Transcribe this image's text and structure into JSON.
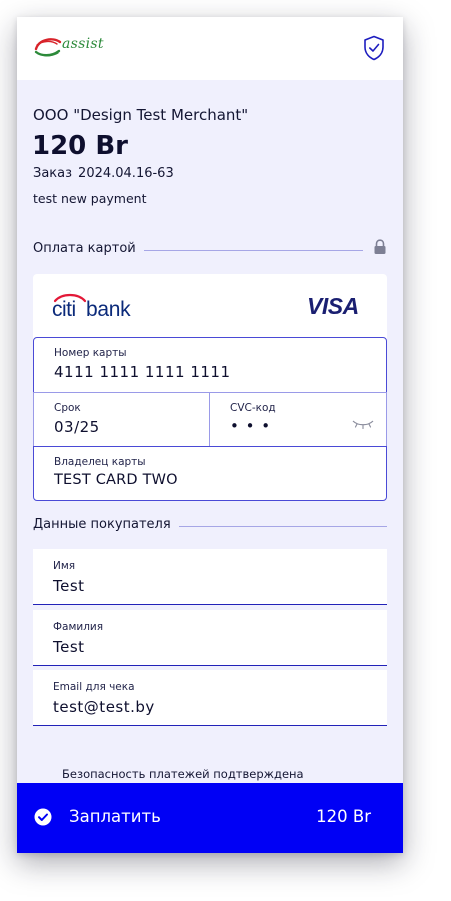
{
  "header": {
    "logo_text": "assist",
    "shield_icon": "shield-check-icon"
  },
  "summary": {
    "merchant": "ООО \"Design Test Merchant\"",
    "amount": "120 Br",
    "order_label": "Заказ",
    "order_number": "2024.04.16-63",
    "description": "test new payment"
  },
  "card_section": {
    "title": "Оплата картой",
    "lock_icon": "lock-icon",
    "bank_name": "citibank",
    "network": "VISA",
    "pan": {
      "label": "Номер карты",
      "value": "4111  1111  1111  1111"
    },
    "expiry": {
      "label": "Срок",
      "value": "03/25"
    },
    "cvc": {
      "label": "CVC-код",
      "value": "• • •"
    },
    "holder": {
      "label": "Владелец карты",
      "value": "TEST CARD TWO"
    }
  },
  "buyer_section": {
    "title": "Данные покупателя",
    "first_name": {
      "label": "Имя",
      "value": "Test"
    },
    "last_name": {
      "label": "Фамилия",
      "value": "Test"
    },
    "email": {
      "label": "Email для чека",
      "value": "test@test.by"
    }
  },
  "footer": {
    "security_note": "Безопасность платежей подтверждена",
    "pay_label": "Заплатить",
    "pay_amount": "120 Br"
  },
  "colors": {
    "accent": "#0000f5",
    "background": "#f0f0fd",
    "field_border": "#4a4ad6",
    "visa": "#1a1f71",
    "citi_red": "#e31837"
  }
}
